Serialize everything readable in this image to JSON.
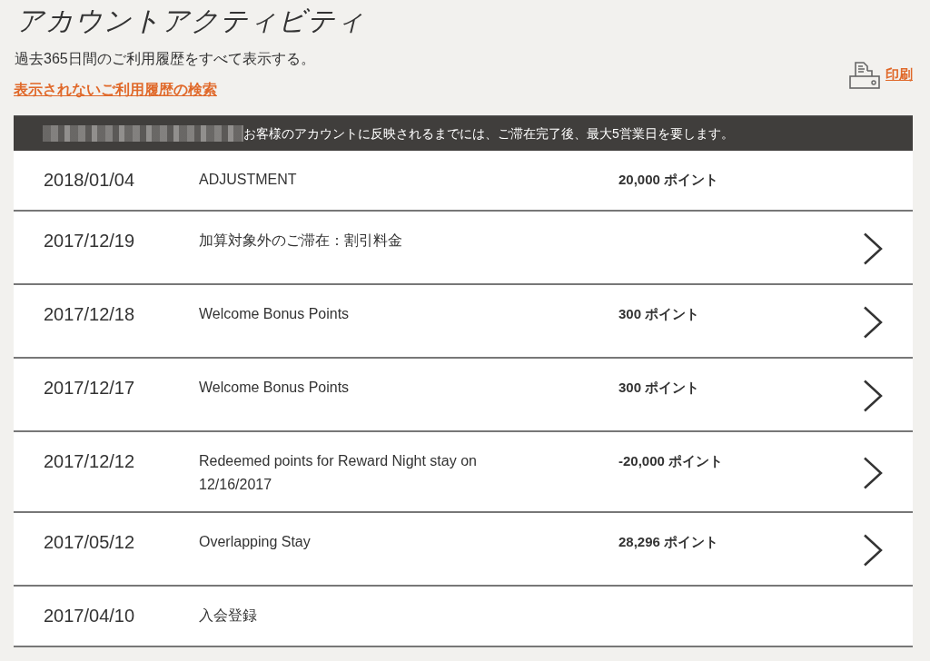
{
  "page": {
    "title": "アカウントアクティビティ",
    "subtitle": "過去365日間のご利用履歴をすべて表示する。",
    "search_link": "表示されないご利用履歴の検索",
    "print_link": "印刷"
  },
  "notice": {
    "redacted": true,
    "text": "お客様のアカウントに反映されるまでには、ご滞在完了後、最大5営業日を要します。"
  },
  "activity": [
    {
      "date": "2018/01/04",
      "description": "ADJUSTMENT",
      "points": "20,000 ポイント",
      "expandable": false
    },
    {
      "date": "2017/12/19",
      "description": "加算対象外のご滞在：割引料金",
      "expandable": true
    },
    {
      "date": "2017/12/18",
      "description": "Welcome Bonus Points",
      "points": "300 ポイント",
      "expandable": true
    },
    {
      "date": "2017/12/17",
      "description": "Welcome Bonus Points",
      "points": "300 ポイント",
      "expandable": true
    },
    {
      "date": "2017/12/12",
      "description": "Redeemed points for Reward Night stay on 12/16/2017",
      "points": "-20,000 ポイント",
      "expandable": true
    },
    {
      "date": "2017/05/12",
      "description": "Overlapping Stay",
      "points": "28,296 ポイント",
      "expandable": true
    },
    {
      "date": "2017/04/10",
      "description": "入会登録",
      "expandable": false
    }
  ]
}
